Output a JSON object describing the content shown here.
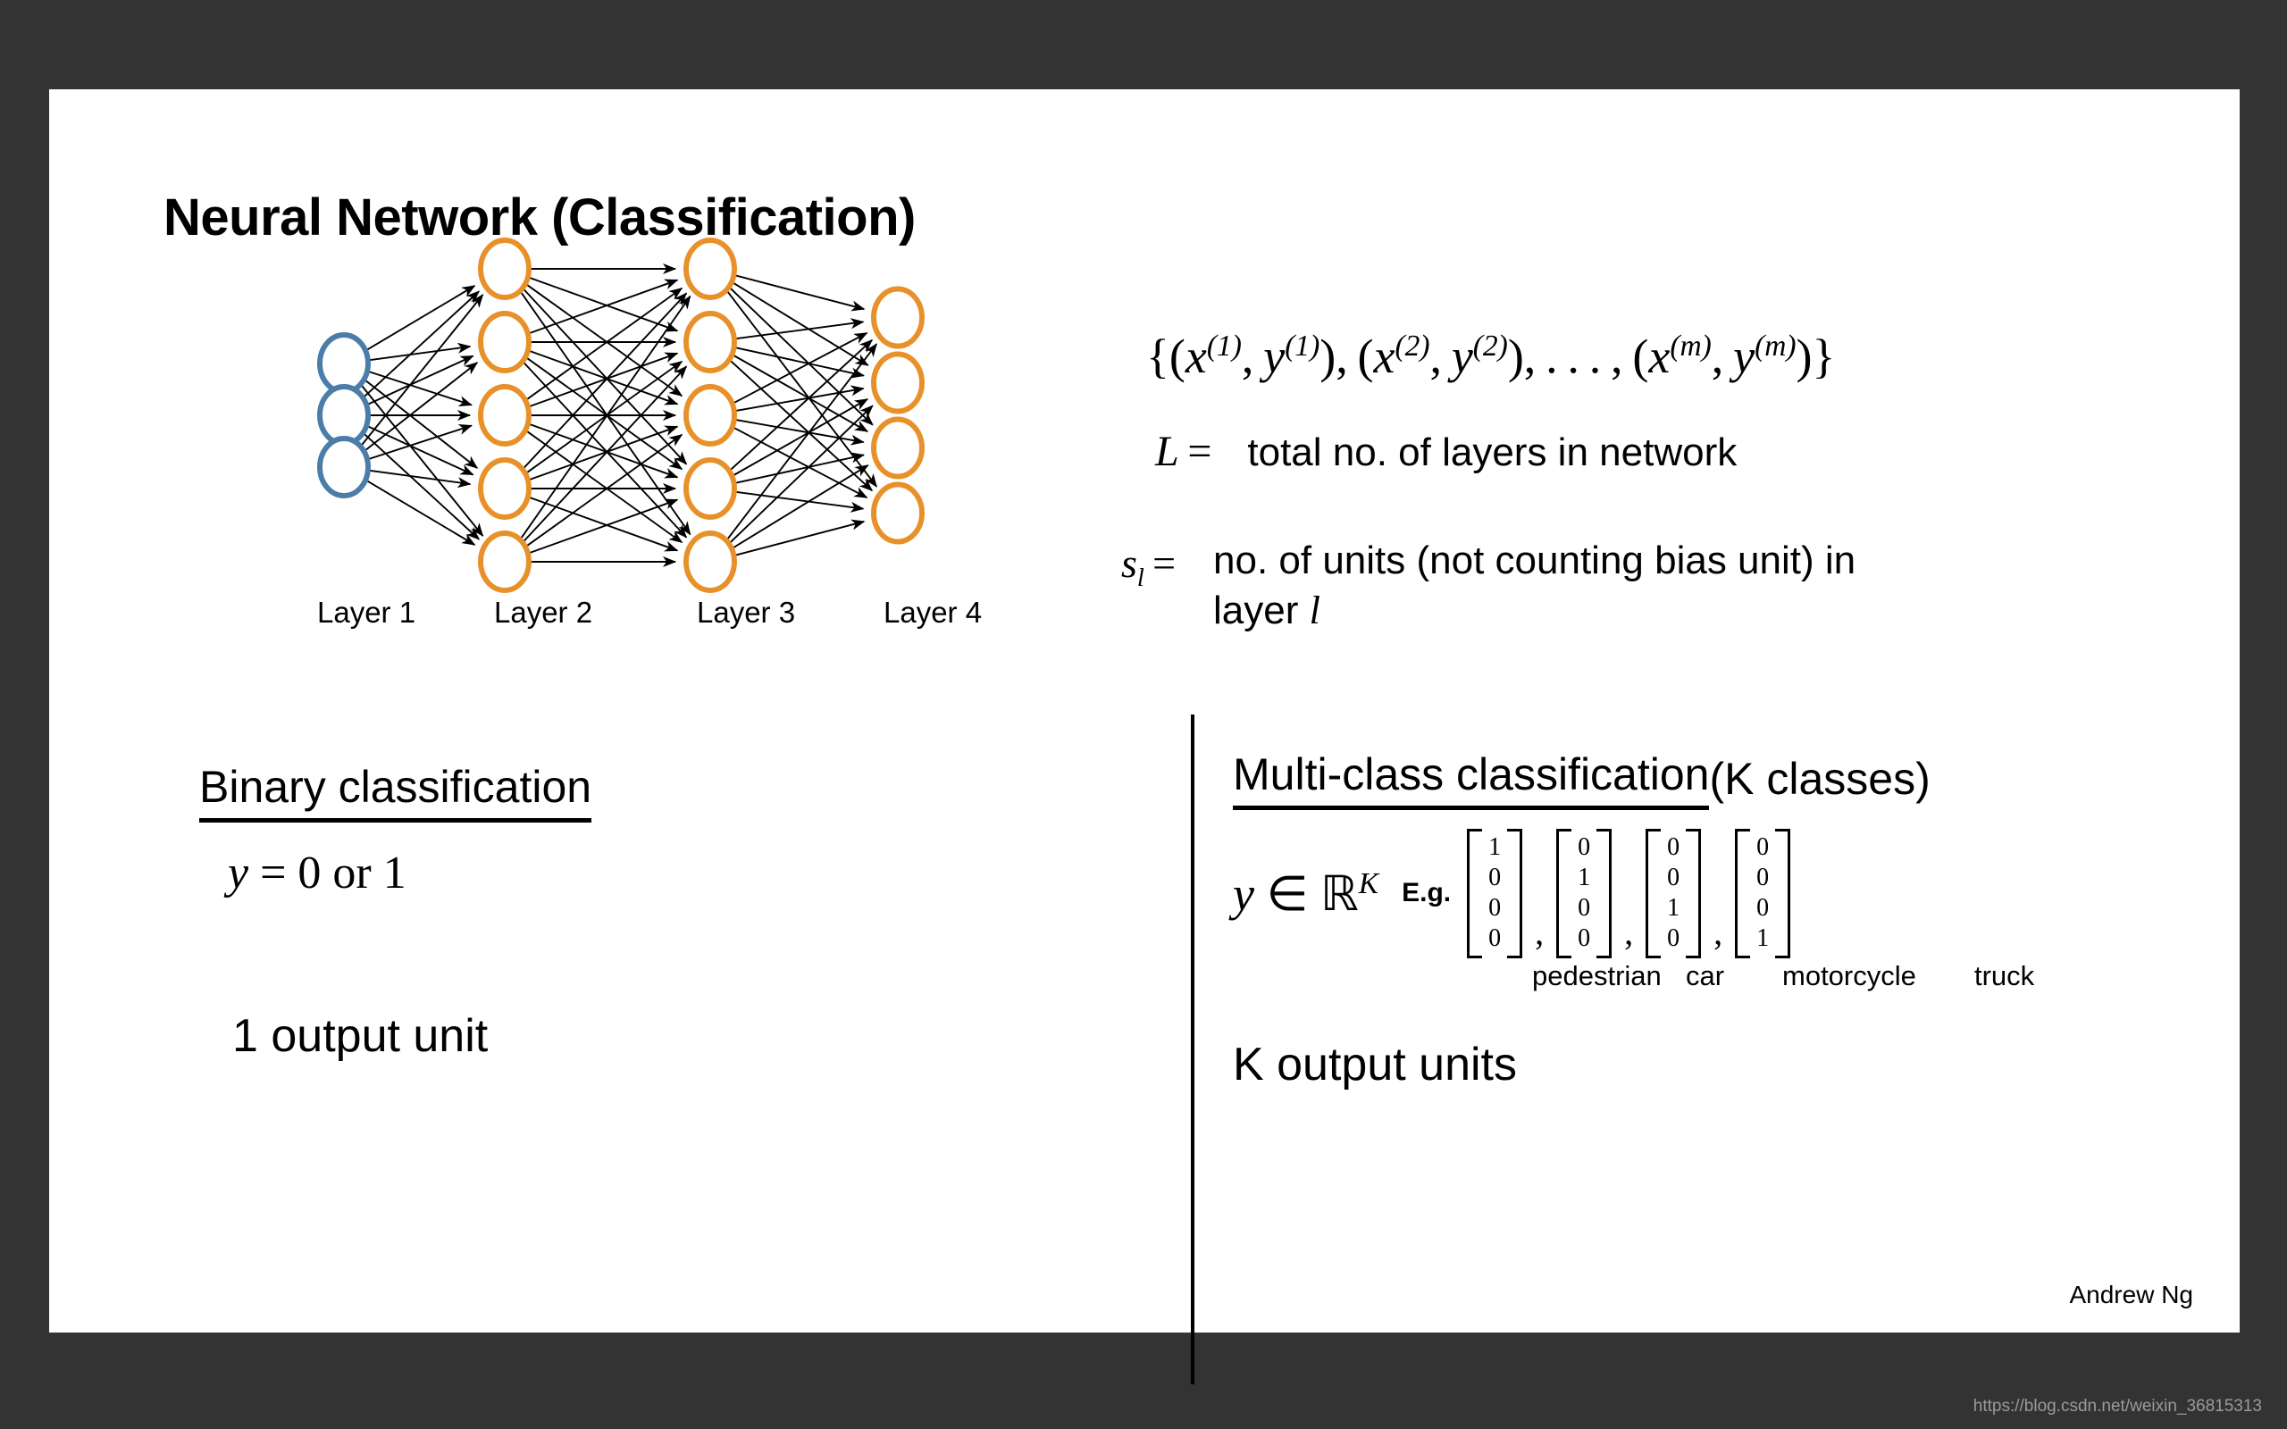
{
  "slide": {
    "title": "Neural Network (Classification)",
    "background_color": "#333333",
    "canvas_color": "#ffffff"
  },
  "network": {
    "node_blue": "#4C7CA8",
    "node_orange": "#E8912B",
    "edge_color": "#000000",
    "layers": [
      {
        "label": "Layer 1",
        "units": 3,
        "color": "#4C7CA8"
      },
      {
        "label": "Layer 2",
        "units": 5,
        "color": "#E8912B"
      },
      {
        "label": "Layer 3",
        "units": 5,
        "color": "#E8912B"
      },
      {
        "label": "Layer 4",
        "units": 4,
        "color": "#E8912B"
      }
    ]
  },
  "definitions": {
    "dataset": "{(x(1), y(1)), (x(2), y(2)), . . . , (x(m), y(m))}",
    "L_symbol": "L =",
    "L_text": "total no. of layers in network",
    "s_symbol": "sl =",
    "s_text_line1": "no. of units (not counting bias unit) in",
    "s_text_line2_prefix": "layer ",
    "s_text_line2_symbol": "l"
  },
  "binary": {
    "heading": "Binary classification",
    "equation_y": "y",
    "equation_rest": " = 0 or 1",
    "output": "1 output unit"
  },
  "multiclass": {
    "heading_underlined": "Multi-class classification ",
    "heading_plain": "(K classes)",
    "y_symbol": "y",
    "y_in": " ∈ ",
    "y_set": "ℝ",
    "y_exponent": "K",
    "eg_label": "E.g.",
    "vectors": [
      {
        "values": [
          "1",
          "0",
          "0",
          "0"
        ],
        "class": "pedestrian"
      },
      {
        "values": [
          "0",
          "1",
          "0",
          "0"
        ],
        "class": "car"
      },
      {
        "values": [
          "0",
          "0",
          "1",
          "0"
        ],
        "class": "motorcycle"
      },
      {
        "values": [
          "0",
          "0",
          "0",
          "1"
        ],
        "class": "truck"
      }
    ],
    "separator": ",",
    "class_labels": "pedestrian  car  motorcycle   truck",
    "output": "K output units"
  },
  "footer": {
    "signature": "Andrew Ng",
    "watermark": "https://blog.csdn.net/weixin_36815313"
  }
}
